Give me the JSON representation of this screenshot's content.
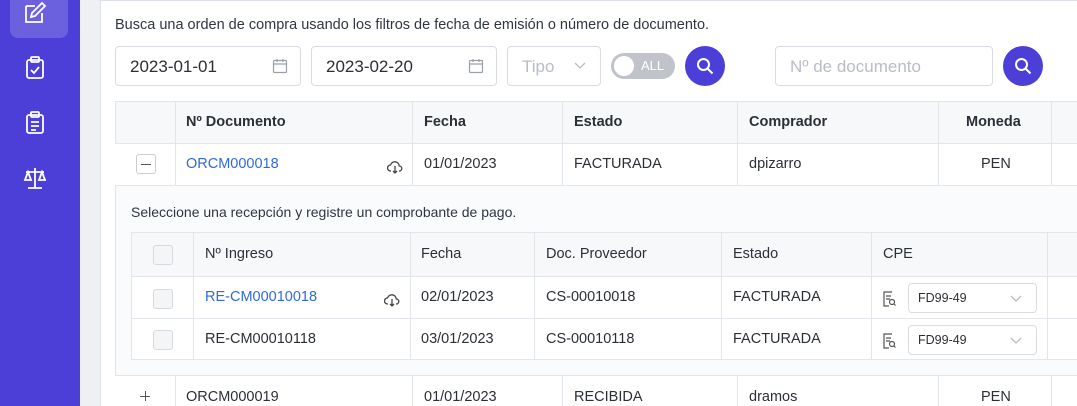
{
  "sidebar": {
    "icons": [
      "edit-icon",
      "clipboard-check-icon",
      "clipboard-list-icon",
      "scale-icon"
    ]
  },
  "filters": {
    "help_text": "Busca una orden de compra usando los filtros de fecha de emisión o número de documento.",
    "date_from": "2023-01-01",
    "date_to": "2023-02-20",
    "tipo_placeholder": "Tipo",
    "toggle_label": "ALL",
    "doc_number_placeholder": "Nº de documento"
  },
  "orders_table": {
    "headers": [
      "Nº Documento",
      "Fecha",
      "Estado",
      "Comprador",
      "Moneda"
    ],
    "rows": [
      {
        "doc": "ORCM000018",
        "fecha": "01/01/2023",
        "estado": "FACTURADA",
        "comprador": "dpizarro",
        "moneda": "PEN",
        "expanded": true
      },
      {
        "doc": "ORCM000019",
        "fecha": "01/01/2023",
        "estado": "RECIBIDA",
        "comprador": "dramos",
        "moneda": "PEN",
        "expanded": false
      }
    ]
  },
  "receptions": {
    "instruction": "Seleccione una recepción y registre un comprobante de pago.",
    "headers": [
      "Nº Ingreso",
      "Fecha",
      "Doc. Proveedor",
      "Estado",
      "CPE"
    ],
    "rows": [
      {
        "ingreso": "RE-CM00010018",
        "fecha": "02/01/2023",
        "doc_proveedor": "CS-00010018",
        "estado": "FACTURADA",
        "cpe": "FD99-49"
      },
      {
        "ingreso": "RE-CM00010118",
        "fecha": "03/01/2023",
        "doc_proveedor": "CS-00010118",
        "estado": "FACTURADA",
        "cpe": "FD99-49"
      }
    ]
  }
}
